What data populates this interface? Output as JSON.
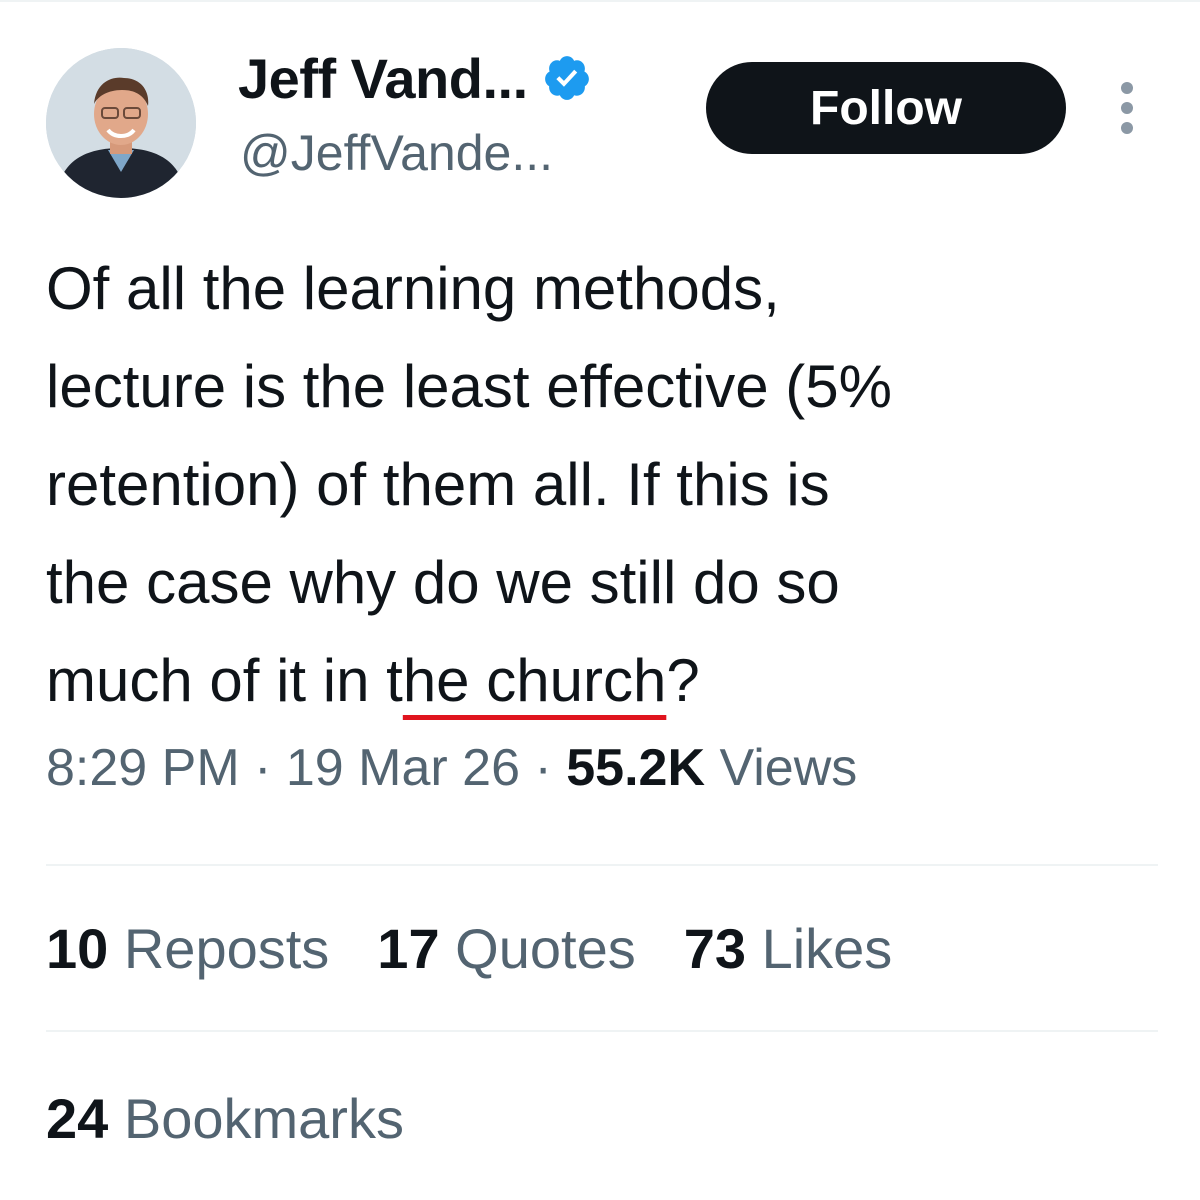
{
  "author": {
    "display_name": "Jeff Vand...",
    "handle": "@JeffVande...",
    "verified": true,
    "verified_color": "#1d9bf0"
  },
  "actions": {
    "follow_label": "Follow"
  },
  "tweet": {
    "text_lines": [
      "Of all the learning methods,",
      "lecture is the least effective (5%",
      "retention) of them all. If this is",
      "the case why do we still do so"
    ],
    "last_line_before": "much of it in t",
    "last_line_underlined": "he church",
    "last_line_after": "?"
  },
  "meta": {
    "time": "8:29 PM",
    "date": "19 Mar 26",
    "separator": "·",
    "views_count": "55.2K",
    "views_label": "Views"
  },
  "stats": {
    "reposts_count": "10",
    "reposts_label": "Reposts",
    "quotes_count": "17",
    "quotes_label": "Quotes",
    "likes_count": "73",
    "likes_label": "Likes",
    "bookmarks_count": "24",
    "bookmarks_label": "Bookmarks"
  },
  "colors": {
    "text_primary": "#0f1419",
    "text_secondary": "#536471",
    "spellcheck_underline": "#e0141e",
    "button_bg": "#0f1419"
  },
  "icons": {
    "verified": "verified-badge-icon",
    "more": "more-vertical-icon"
  }
}
